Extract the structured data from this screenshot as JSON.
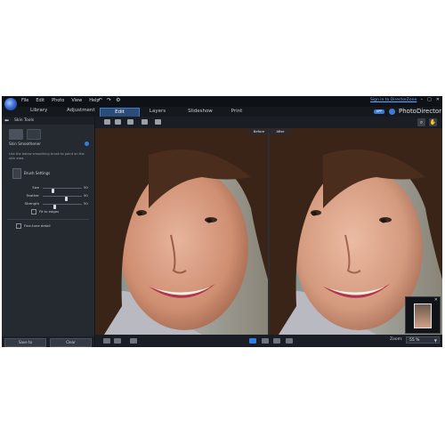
{
  "menu": [
    "File",
    "Edit",
    "Photo",
    "View",
    "Help"
  ],
  "signin_text": "Sign in to DirectorZone",
  "left_tabs": [
    "Library",
    "Adjustment"
  ],
  "modes": [
    "Edit",
    "Layers",
    "Slideshow",
    "Print"
  ],
  "active_mode": "Edit",
  "app_badge": "APP",
  "brand": "PhotoDirector",
  "panel": {
    "title": "Skin Tools",
    "section": "Skin Smoothener",
    "hint": "Use the below smoothing brush to paint on the skin area.",
    "brush_settings": "Brush Settings",
    "sliders": [
      {
        "label": "Size",
        "value": "50",
        "fraction": 0.25
      },
      {
        "label": "Feather",
        "value": "50",
        "fraction": 0.6
      },
      {
        "label": "Strength",
        "value": "50",
        "fraction": 0.3
      }
    ],
    "fit_edges": "Fit to edges",
    "fine_tune": "Fine-tune detail",
    "save_label": "Save to",
    "clear_label": "Clear"
  },
  "before_label": "Before",
  "after_label": "After",
  "zoom": {
    "label": "Zoom:",
    "value": "55 %"
  },
  "colors": {
    "accent": "#3f7ad0",
    "link": "#6aa7ff",
    "panel": "#252a31",
    "toolbar": "#1a1e24"
  }
}
